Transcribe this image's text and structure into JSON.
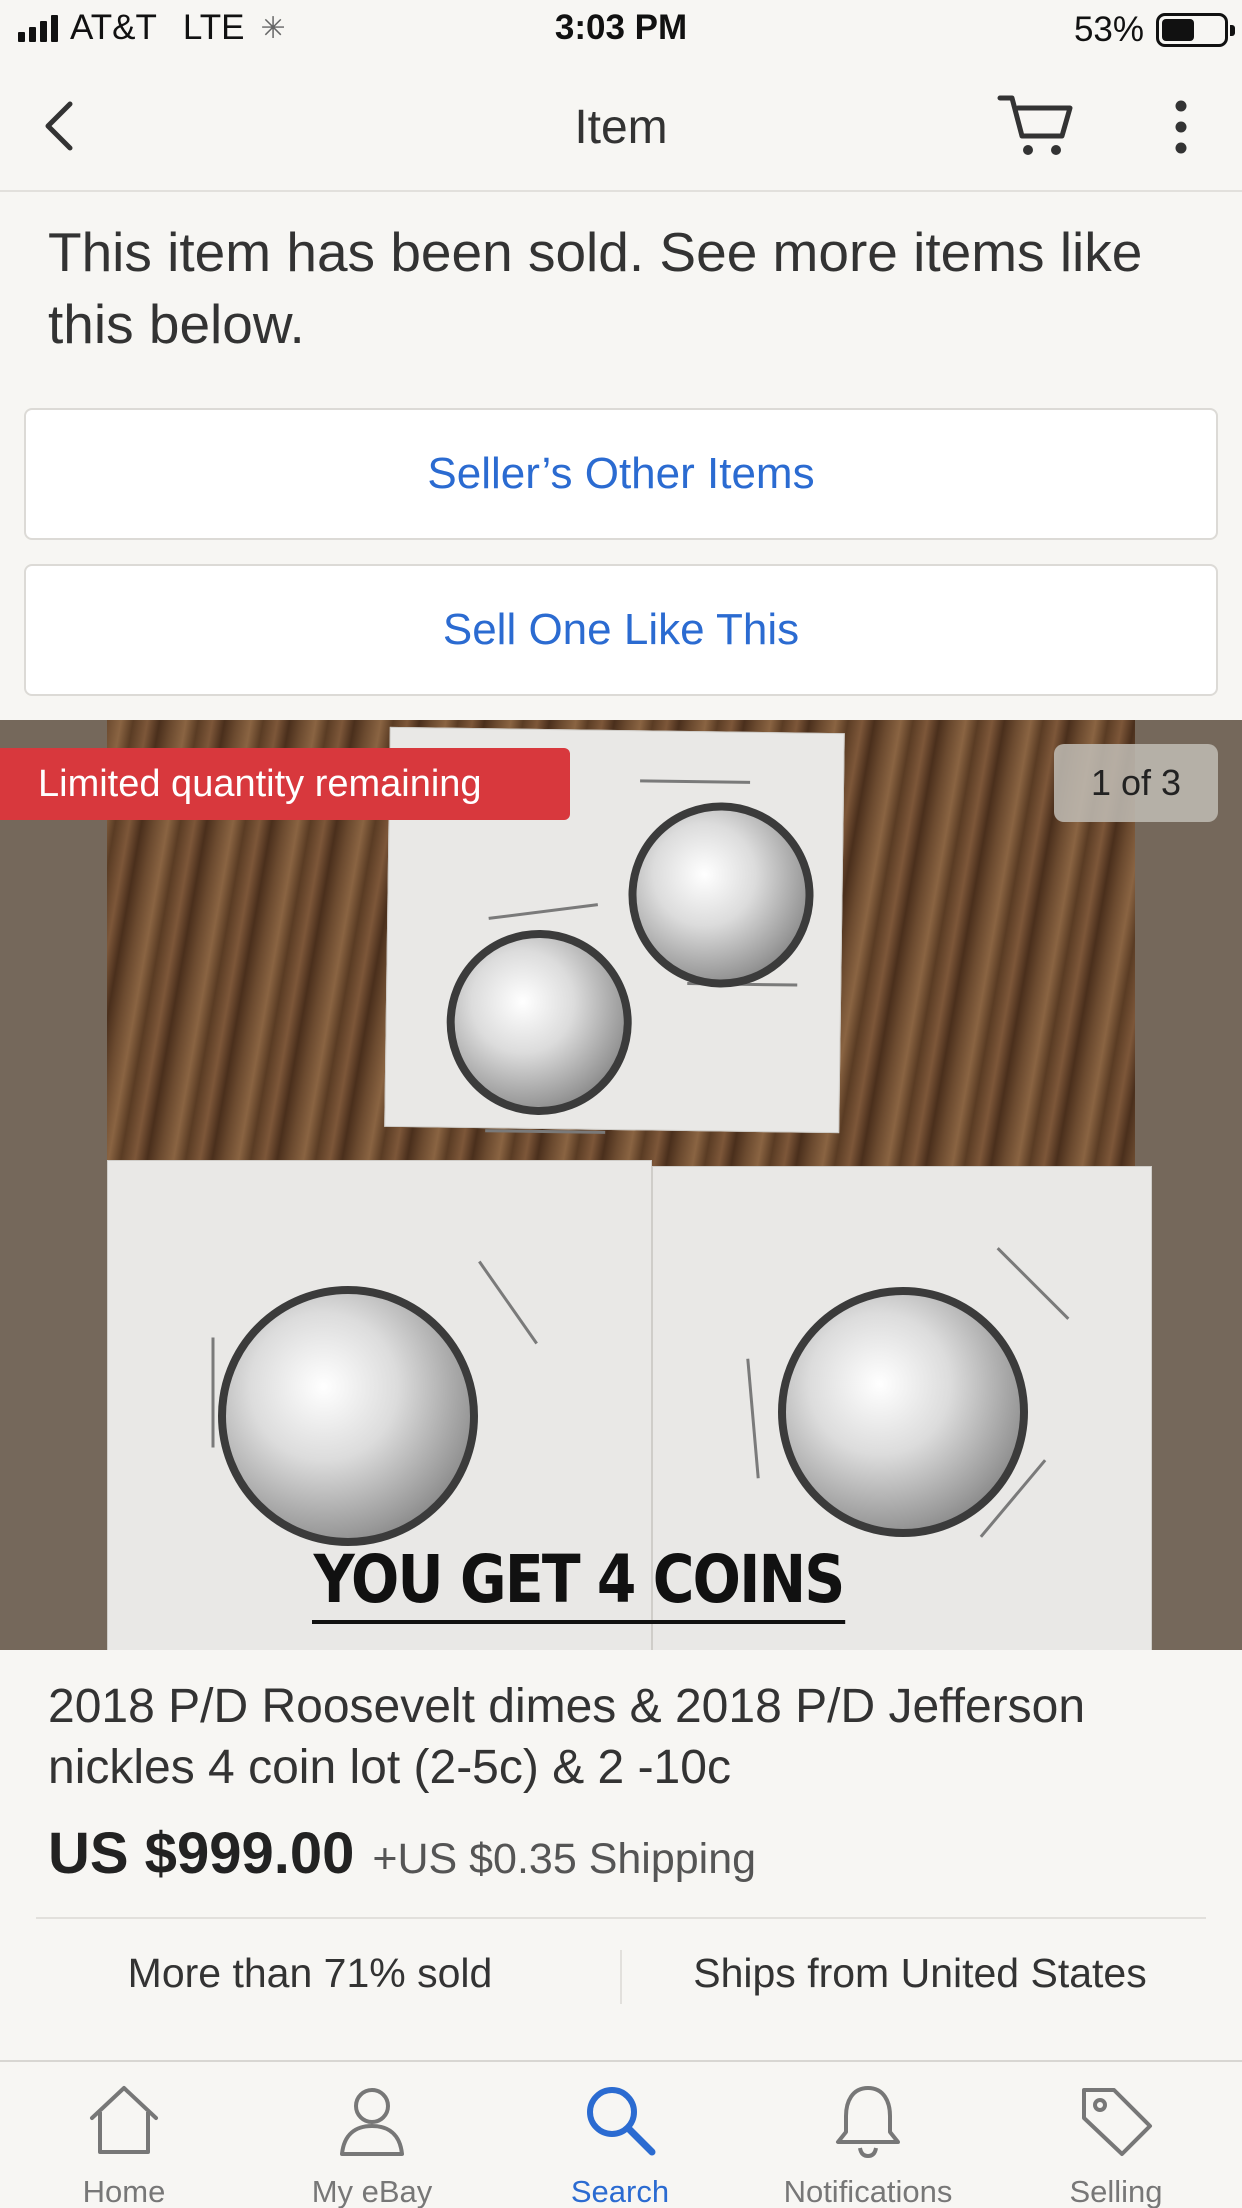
{
  "status_bar": {
    "carrier": "AT&T",
    "network": "LTE",
    "time": "3:03 PM",
    "battery": "53%",
    "battery_level": 0.53
  },
  "nav": {
    "title": "Item",
    "back_icon": "chevron-left-icon",
    "cart_icon": "cart-icon",
    "more_icon": "more-vertical-icon"
  },
  "sold_message": "This item has been sold. See more items like this below.",
  "actions": {
    "sellers_other_items": "Seller’s Other Items",
    "sell_one_like_this": "Sell One Like This"
  },
  "gallery": {
    "badge": "Limited quantity remaining",
    "counter": "1 of 3",
    "caption": "YOU GET 4 COINS"
  },
  "item": {
    "title": "2018 P/D Roosevelt dimes & 2018 P/D Jefferson nickles 4 coin lot (2-5c) & 2 -10c",
    "price": "US $999.00",
    "shipping": "+US $0.35 Shipping",
    "sold_stat": "More than 71% sold",
    "ships_from": "Ships from United States"
  },
  "tabs": [
    {
      "label": "Home",
      "icon": "home-icon"
    },
    {
      "label": "My eBay",
      "icon": "user-icon"
    },
    {
      "label": "Search",
      "icon": "search-icon",
      "active": true
    },
    {
      "label": "Notifications",
      "icon": "bell-icon"
    },
    {
      "label": "Selling",
      "icon": "tag-icon"
    }
  ],
  "colors": {
    "link_blue": "#2b6bd1",
    "badge_red": "#d8383d",
    "background": "#f7f6f3"
  }
}
